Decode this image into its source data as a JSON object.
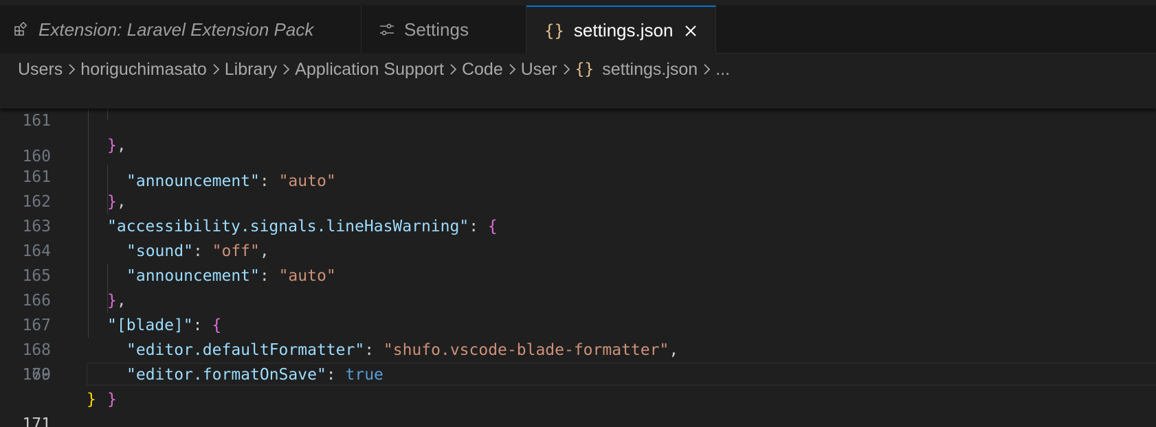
{
  "tabs": [
    {
      "label": "Extension: Laravel Extension Pack",
      "icon": "extensions-icon",
      "active": false
    },
    {
      "label": "Settings",
      "icon": "settings-sliders-icon",
      "active": false
    },
    {
      "label": "settings.json",
      "icon": "json-braces-icon",
      "active": true,
      "glyph": "{}"
    }
  ],
  "breadcrumb": {
    "items": [
      "Users",
      "horiguchimasato",
      "Library",
      "Application Support",
      "Code",
      "User"
    ],
    "file": "settings.json",
    "file_glyph": "{}",
    "more": "..."
  },
  "editor": {
    "sticky": {
      "number": "161",
      "text": "},"
    },
    "partial": {
      "number": "160",
      "key": "\"announcement\"",
      "value": "\"auto\""
    },
    "lines": [
      {
        "number": "161"
      },
      {
        "number": "162",
        "key": "\"accessibility.signals.lineHasWarning\""
      },
      {
        "number": "163",
        "key": "\"sound\"",
        "value": "\"off\""
      },
      {
        "number": "164",
        "key": "\"announcement\"",
        "value": "\"auto\""
      },
      {
        "number": "165"
      },
      {
        "number": "166",
        "key": "\"[blade]\""
      },
      {
        "number": "167",
        "key": "\"editor.defaultFormatter\"",
        "value": "\"shufo.vscode-blade-formatter\""
      },
      {
        "number": "168",
        "key": "\"editor.formatOnSave\"",
        "value": "true"
      },
      {
        "number": "169"
      },
      {
        "number": "170"
      },
      {
        "number": "171"
      }
    ]
  },
  "colors": {
    "key": "#9cdcfe",
    "string": "#ce9178",
    "literal": "#569cd6",
    "bracket_level1": "#ffd700",
    "bracket_level2": "#da70d6",
    "active_tab_border": "#0078d4",
    "json_icon": "#e2c08d"
  }
}
